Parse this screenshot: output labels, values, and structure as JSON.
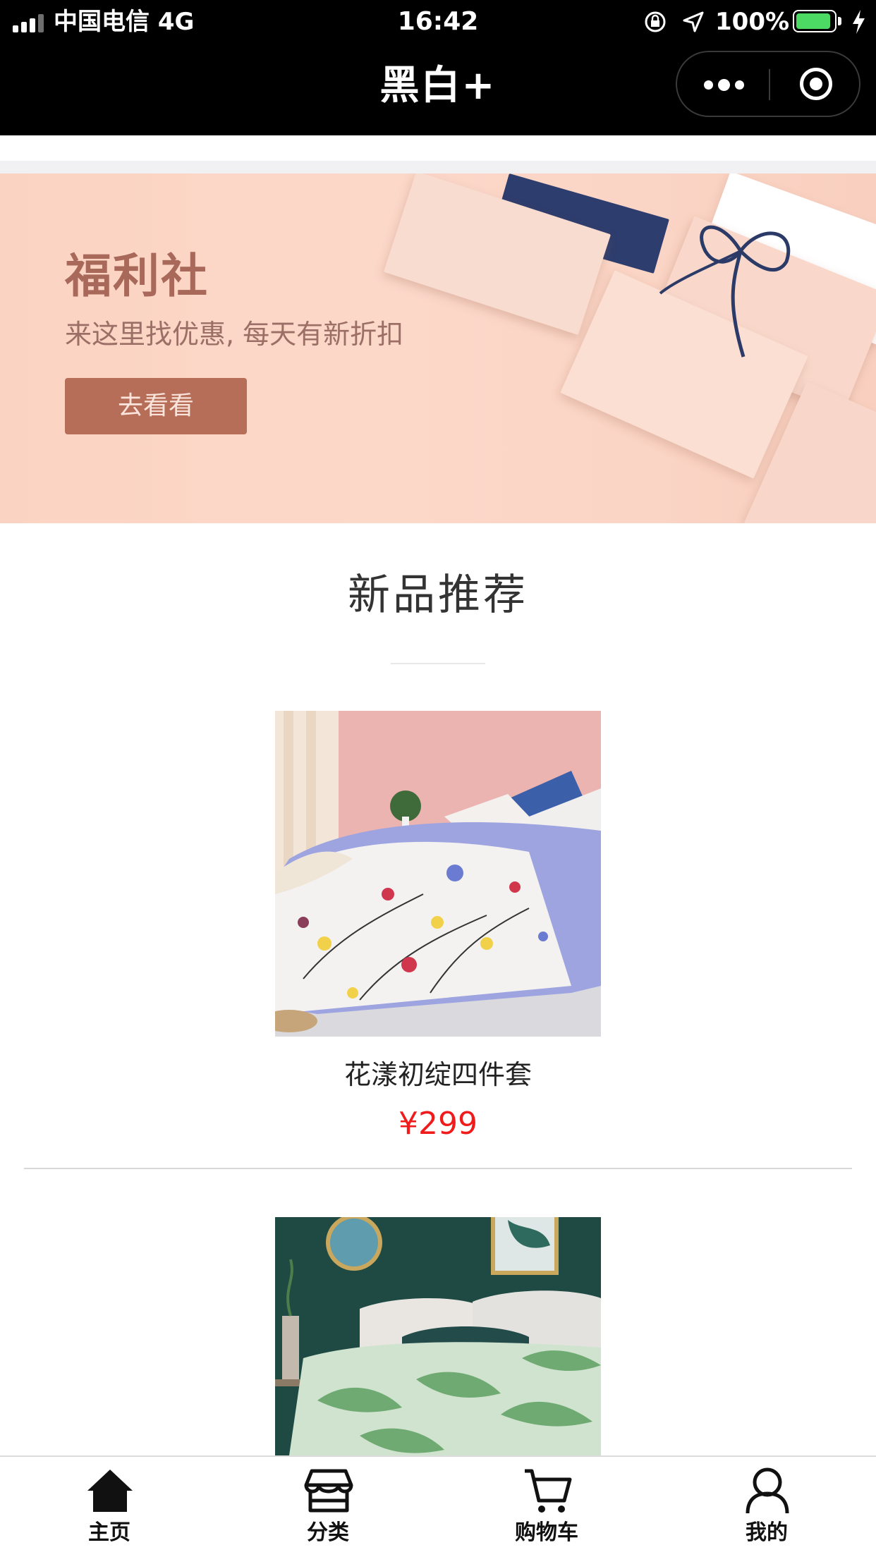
{
  "status_bar": {
    "carrier": "中国电信   4G",
    "time": "16:42",
    "battery": "100%",
    "battery_level": 1.0,
    "battery_color": "#4cd964",
    "icons": [
      "signal-icon",
      "rotation-lock-icon",
      "location-arrow-icon",
      "battery-icon",
      "charging-bolt-icon"
    ]
  },
  "nav": {
    "title": "黑白+",
    "icons": [
      "more-dots-icon",
      "close-target-icon"
    ]
  },
  "banner": {
    "title": "福利社",
    "subtitle": "来这里找优惠, 每天有新折扣",
    "button_label": "去看看",
    "colors": {
      "background": "#fbd3c2",
      "title": "#a8695a",
      "button": "#b76e58"
    }
  },
  "section": {
    "title": "新品推荐"
  },
  "products": [
    {
      "name": "花漾初绽四件套",
      "price": "¥299"
    },
    {
      "name": "",
      "price": ""
    }
  ],
  "price_color": "#f01b1b",
  "tab_bar": {
    "tabs": [
      {
        "label": "主页",
        "icon": "home-icon"
      },
      {
        "label": "分类",
        "icon": "store-icon"
      },
      {
        "label": "购物车",
        "icon": "cart-icon"
      },
      {
        "label": "我的",
        "icon": "user-icon"
      }
    ]
  }
}
